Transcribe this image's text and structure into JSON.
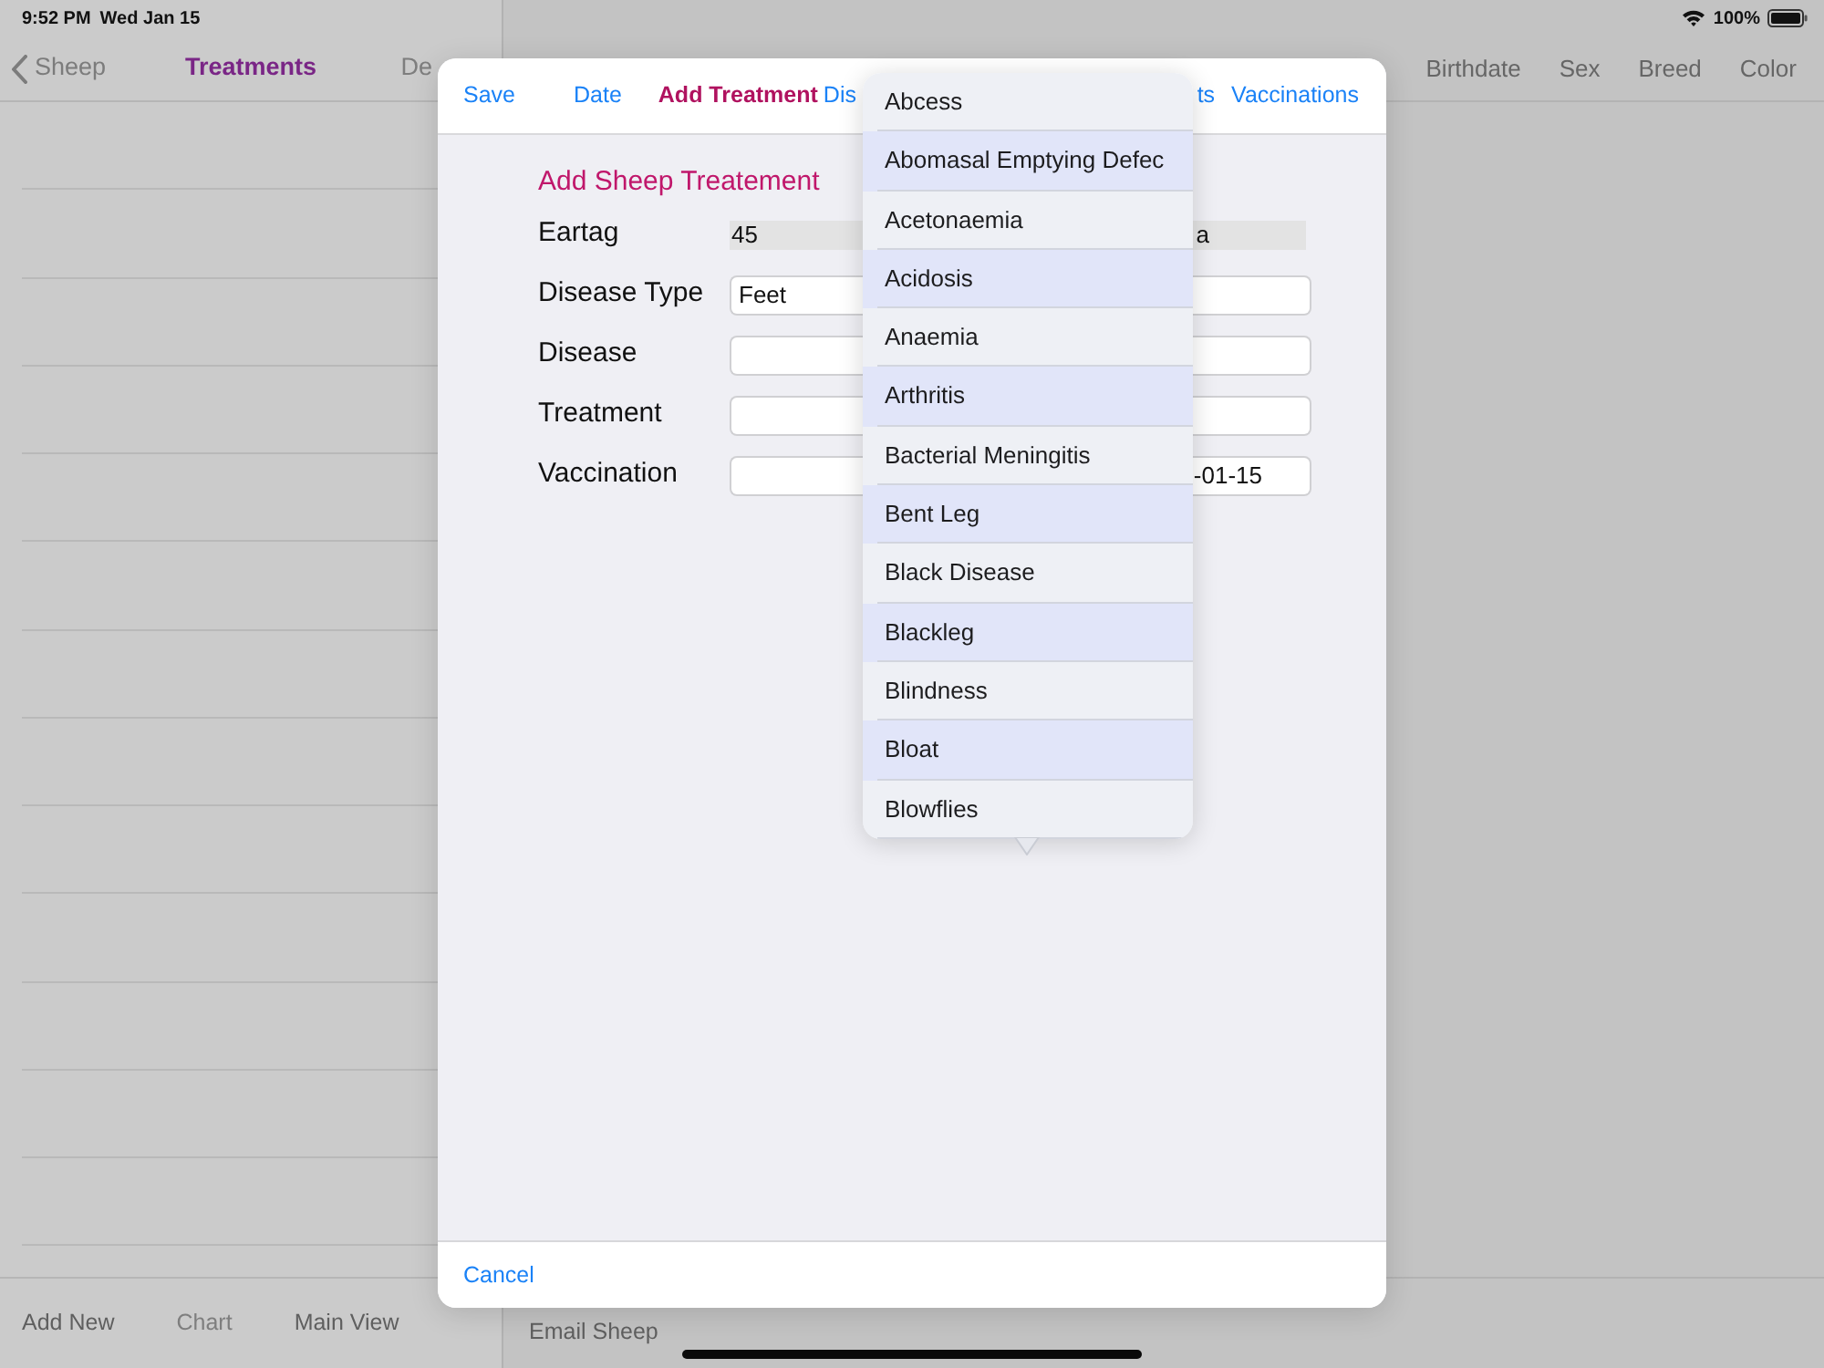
{
  "status_bar": {
    "time": "9:52 PM",
    "date": "Wed Jan 15",
    "battery": "100%"
  },
  "left_panel": {
    "back": "Sheep",
    "title": "Treatments",
    "cut_action": {
      "label": "De",
      "disabled": true
    },
    "toolbar": [
      {
        "label": "Add New",
        "disabled": false
      },
      {
        "label": "Chart",
        "disabled": true
      },
      {
        "label": "Main View",
        "disabled": false
      }
    ]
  },
  "right_panel": {
    "columns": [
      "Birthdate",
      "Sex",
      "Breed",
      "Color"
    ],
    "toolbar": [
      "Email Sheep"
    ]
  },
  "modal": {
    "header": [
      {
        "label": "Save",
        "kind": "button"
      },
      {
        "label": "Date",
        "kind": "button"
      },
      {
        "label": "Add Treatment",
        "kind": "title"
      },
      {
        "label": "Dis",
        "kind": "button"
      },
      {
        "label": "ts",
        "kind": "button"
      },
      {
        "label": "Vaccinations",
        "kind": "button"
      }
    ],
    "form_title": "Add Sheep Treatement",
    "fields": [
      {
        "label": "Eartag",
        "kind": "readonly",
        "value": "45",
        "trailing": "a"
      },
      {
        "label": "Disease Type",
        "kind": "input",
        "value": "Feet"
      },
      {
        "label": "Disease",
        "kind": "input"
      },
      {
        "label": "Treatment",
        "kind": "input"
      },
      {
        "label": "Vaccination",
        "kind": "input",
        "trailing": "-01-15"
      }
    ],
    "cancel": "Cancel"
  },
  "dropdown": {
    "items": [
      "Abcess",
      "Abomasal Emptying Defec",
      "Acetonaemia",
      "Acidosis",
      "Anaemia",
      "Arthritis",
      "Bacterial Meningitis",
      "Bent Leg",
      "Black Disease",
      "Blackleg",
      "Blindness",
      "Bloat",
      "Blowflies"
    ]
  }
}
